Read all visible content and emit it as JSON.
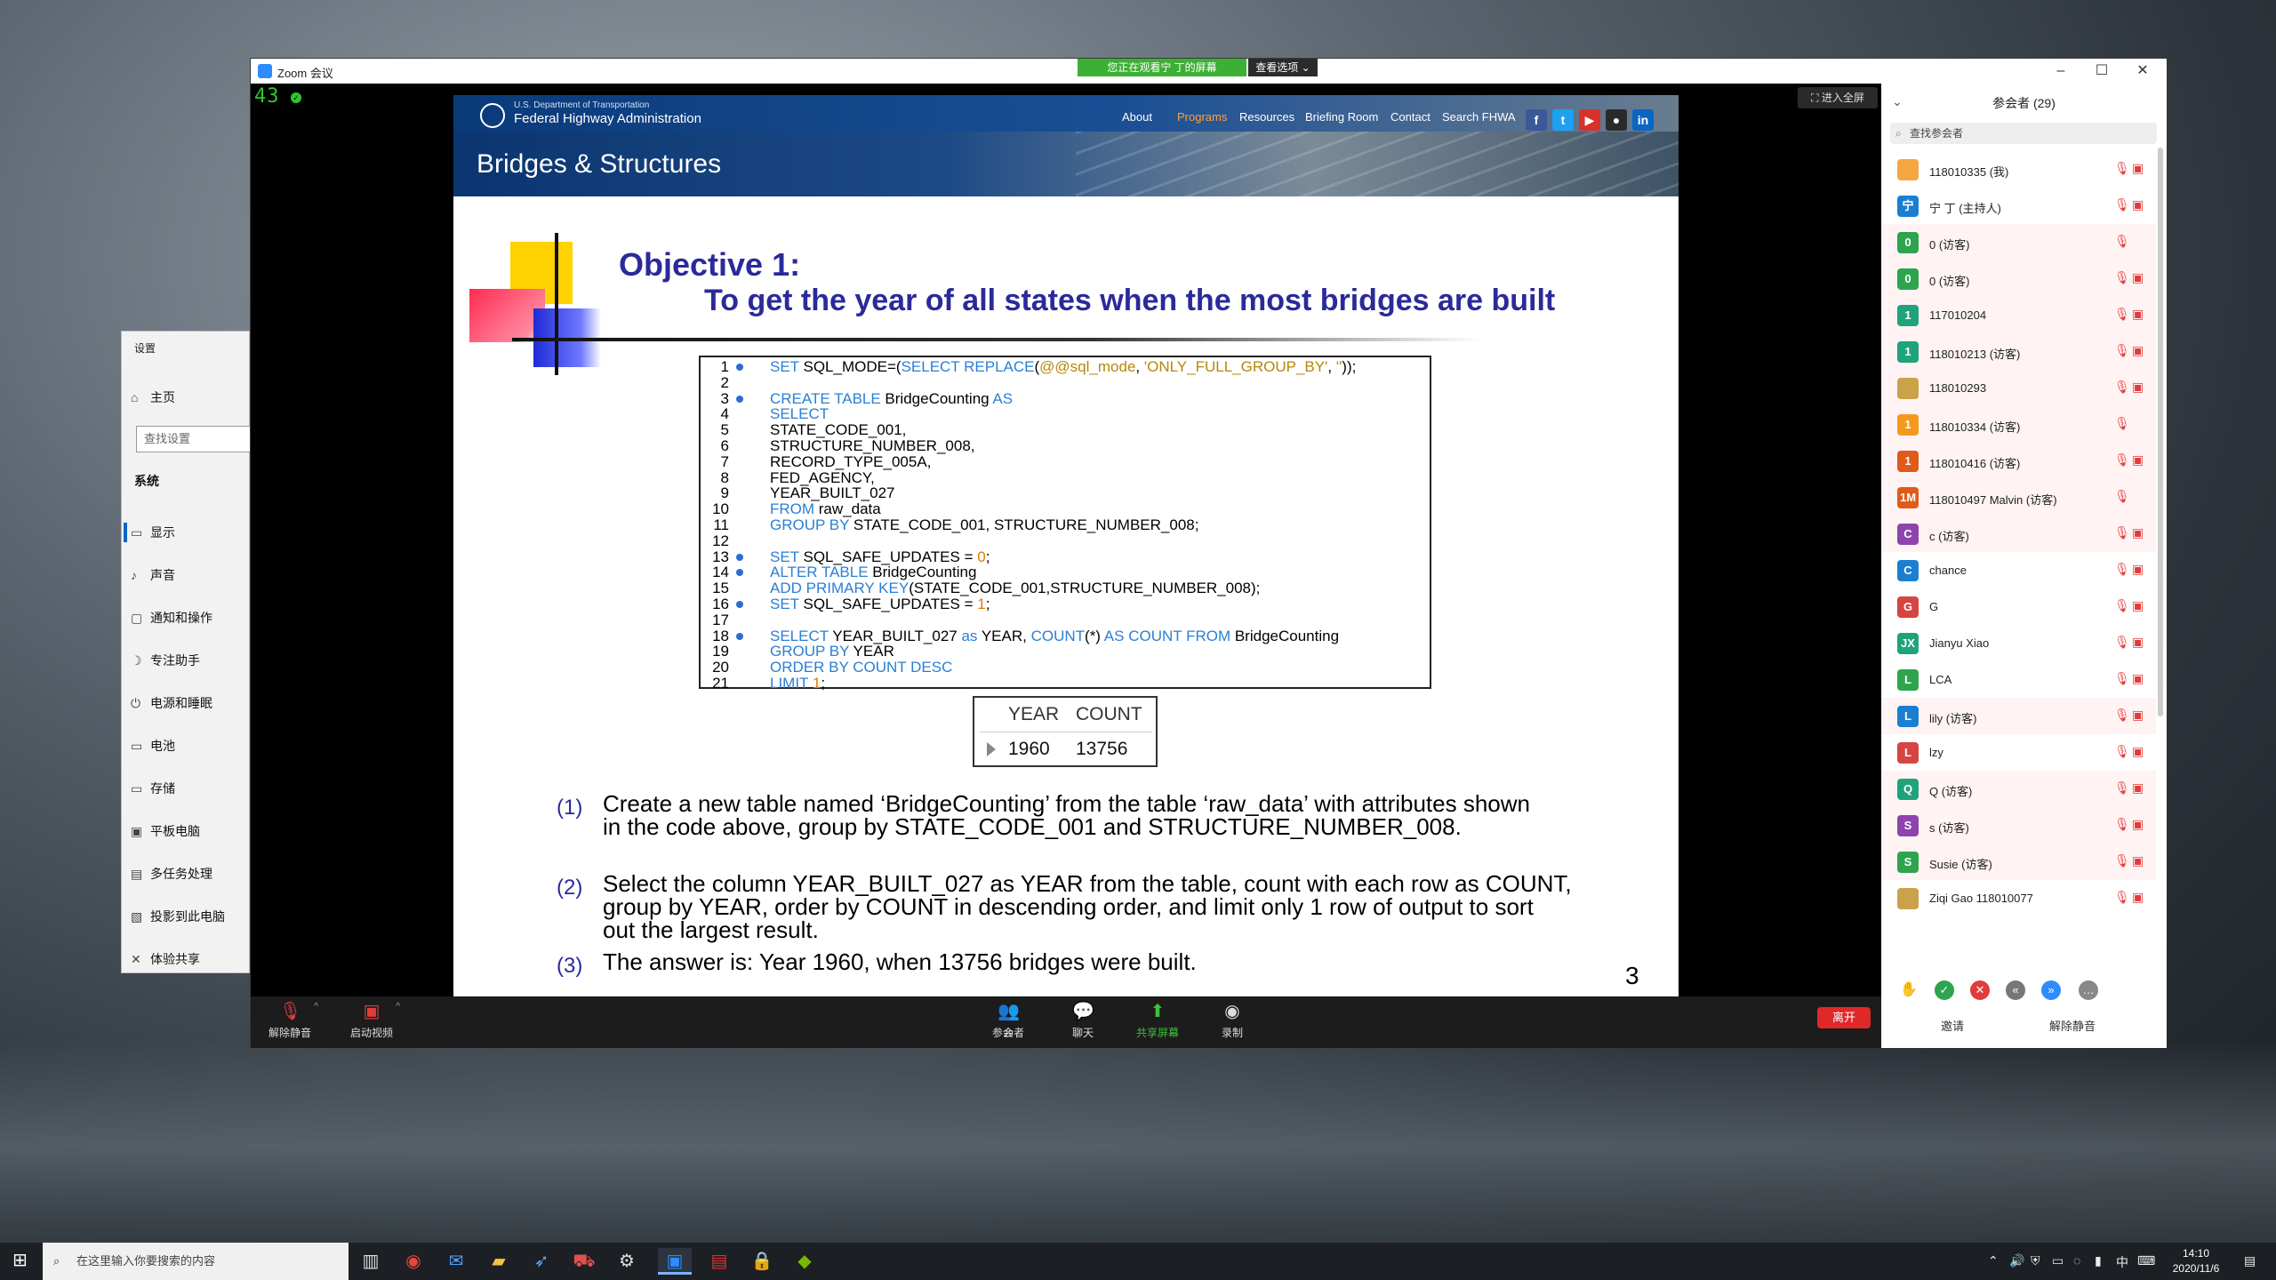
{
  "zoom": {
    "title": "Zoom 会议",
    "banner": "您正在观看宁 丁的屏幕",
    "view_options": "查看选项 ⌄",
    "counter": "43",
    "fullscreen": "进入全屏",
    "toolbar": {
      "mute": "解除静音",
      "video": "启动视频",
      "participants": "参会者",
      "participants_count": "29",
      "chat": "聊天",
      "share": "共享屏幕",
      "record": "录制",
      "leave": "离开"
    }
  },
  "slide": {
    "dept": "U.S. Department of Transportation",
    "agency": "Federal Highway Administration",
    "nav": [
      "About",
      "Programs",
      "Resources",
      "Briefing Room",
      "Contact",
      "Search FHWA"
    ],
    "section_title": "Bridges & Structures",
    "objective_title": "Objective 1:",
    "objective_sub": "To get the year of all states when the most bridges are built",
    "code": [
      "SET SQL_MODE=(SELECT REPLACE(@@sql_mode, 'ONLY_FULL_GROUP_BY', ''));",
      "",
      "CREATE TABLE BridgeCounting AS",
      "SELECT",
      "STATE_CODE_001,",
      "STRUCTURE_NUMBER_008,",
      "RECORD_TYPE_005A,",
      "FED_AGENCY,",
      "YEAR_BUILT_027",
      "FROM raw_data",
      "GROUP BY STATE_CODE_001, STRUCTURE_NUMBER_008;",
      "",
      "SET SQL_SAFE_UPDATES = 0;",
      "ALTER TABLE BridgeCounting",
      "ADD PRIMARY KEY(STATE_CODE_001,STRUCTURE_NUMBER_008);",
      "SET SQL_SAFE_UPDATES = 1;",
      "",
      "SELECT YEAR_BUILT_027 as YEAR, COUNT(*) AS COUNT FROM BridgeCounting",
      "GROUP BY YEAR",
      "ORDER BY COUNT DESC",
      "LIMIT 1;"
    ],
    "result": {
      "headers": [
        "YEAR",
        "COUNT"
      ],
      "row": [
        "1960",
        "13756"
      ]
    },
    "items": [
      {
        "num": "(1)",
        "lines": [
          "Create a new table named ‘BridgeCounting’ from the table ‘raw_data’ with attributes shown",
          "in the code above, group by STATE_CODE_001 and STRUCTURE_NUMBER_008."
        ]
      },
      {
        "num": "(2)",
        "lines": [
          "Select the column YEAR_BUILT_027 as YEAR from the table, count with each row as COUNT,",
          "group by YEAR, order by COUNT in descending order, and limit only 1 row of output to sort",
          "out the largest result."
        ]
      },
      {
        "num": "(3)",
        "lines": [
          "The answer is: Year 1960, when 13756 bridges were built."
        ]
      }
    ],
    "page": "3"
  },
  "participants": {
    "title": "参会者 (29)",
    "search_placeholder": "查找参会者",
    "list": [
      {
        "initial": "",
        "color": "#f4a640",
        "name": "118010335 (我)",
        "muted_bg": false,
        "cam": true
      },
      {
        "initial": "宁",
        "color": "#1a7fd0",
        "name": "宁 丁 (主持人)",
        "muted_bg": false,
        "cam": true
      },
      {
        "initial": "0",
        "color": "#2ea44f",
        "name": "0 (访客)",
        "muted_bg": true,
        "cam": false
      },
      {
        "initial": "0",
        "color": "#2ea44f",
        "name": "0 (访客)",
        "muted_bg": true,
        "cam": true
      },
      {
        "initial": "1",
        "color": "#1fa37a",
        "name": "117010204",
        "muted_bg": true,
        "cam": true
      },
      {
        "initial": "1",
        "color": "#1fa37a",
        "name": "118010213 (访客)",
        "muted_bg": true,
        "cam": true
      },
      {
        "initial": "",
        "color": "#c9a24a",
        "name": "118010293",
        "muted_bg": true,
        "cam": true
      },
      {
        "initial": "1",
        "color": "#f39a1e",
        "name": "118010334 (访客)",
        "muted_bg": true,
        "cam": false
      },
      {
        "initial": "1",
        "color": "#e05a1a",
        "name": "118010416 (访客)",
        "muted_bg": true,
        "cam": true
      },
      {
        "initial": "1M",
        "color": "#e05a1a",
        "name": "118010497 Malvin (访客)",
        "muted_bg": true,
        "cam": false
      },
      {
        "initial": "C",
        "color": "#8e44ad",
        "name": "c (访客)",
        "muted_bg": true,
        "cam": true
      },
      {
        "initial": "C",
        "color": "#1a7fd0",
        "name": "chance",
        "muted_bg": false,
        "cam": true
      },
      {
        "initial": "G",
        "color": "#d64541",
        "name": "G",
        "muted_bg": false,
        "cam": true
      },
      {
        "initial": "JX",
        "color": "#1fa37a",
        "name": "Jianyu Xiao",
        "muted_bg": false,
        "cam": true
      },
      {
        "initial": "L",
        "color": "#2ea44f",
        "name": "LCA",
        "muted_bg": false,
        "cam": true
      },
      {
        "initial": "L",
        "color": "#1a7fd0",
        "name": "lily (访客)",
        "muted_bg": true,
        "cam": true
      },
      {
        "initial": "L",
        "color": "#d64541",
        "name": "lzy",
        "muted_bg": false,
        "cam": true
      },
      {
        "initial": "Q",
        "color": "#1fa37a",
        "name": "Q (访客)",
        "muted_bg": true,
        "cam": true
      },
      {
        "initial": "S",
        "color": "#8e44ad",
        "name": "s (访客)",
        "muted_bg": true,
        "cam": true
      },
      {
        "initial": "S",
        "color": "#2ea44f",
        "name": "Susie (访客)",
        "muted_bg": true,
        "cam": true
      },
      {
        "initial": "",
        "color": "#c9a24a",
        "name": "Ziqi Gao 118010077",
        "muted_bg": false,
        "cam": true
      }
    ],
    "invite": "邀请",
    "unmute_all": "解除静音"
  },
  "settings": {
    "title": "设置",
    "home": "主页",
    "search_placeholder": "查找设置",
    "section": "系统",
    "items": [
      "显示",
      "声音",
      "通知和操作",
      "专注助手",
      "电源和睡眠",
      "电池",
      "存储",
      "平板电脑",
      "多任务处理",
      "投影到此电脑",
      "体验共享"
    ]
  },
  "taskbar": {
    "search_placeholder": "在这里输入你要搜索的内容",
    "ime": "中",
    "time": "14:10",
    "date": "2020/11/6"
  }
}
